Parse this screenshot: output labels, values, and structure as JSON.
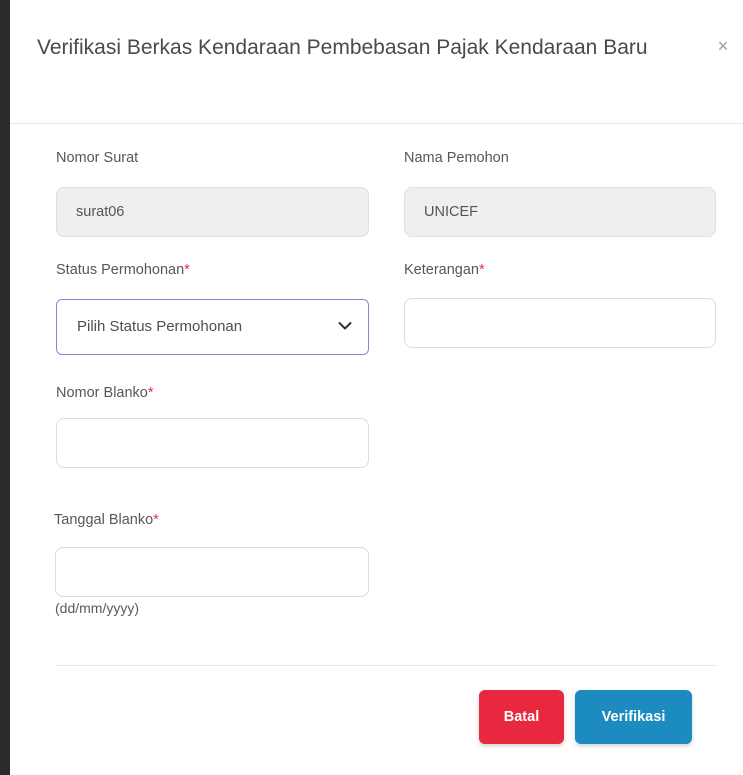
{
  "modal": {
    "title": "Verifikasi Berkas Kendaraan Pembebasan Pajak Kendaraan Baru",
    "close_symbol": "×"
  },
  "form": {
    "nomor_surat": {
      "label": "Nomor Surat",
      "value": "surat06"
    },
    "nama_pemohon": {
      "label": "Nama Pemohon",
      "value": "UNICEF"
    },
    "status_permohonan": {
      "label": "Status Permohonan",
      "required_mark": "*",
      "selected": "Pilih Status Permohonan"
    },
    "keterangan": {
      "label": "Keterangan",
      "required_mark": "*",
      "value": ""
    },
    "nomor_blanko": {
      "label": "Nomor Blanko",
      "required_mark": "*",
      "value": ""
    },
    "tanggal_blanko": {
      "label": "Tanggal Blanko",
      "required_mark": "*",
      "value": "",
      "hint": "(dd/mm/yyyy)"
    }
  },
  "footer": {
    "cancel_label": "Batal",
    "verify_label": "Verifikasi"
  },
  "colors": {
    "required": "#dc3545",
    "cancel": "#e8283f",
    "verify": "#1b8bc0",
    "select_border": "#8a86d8"
  }
}
